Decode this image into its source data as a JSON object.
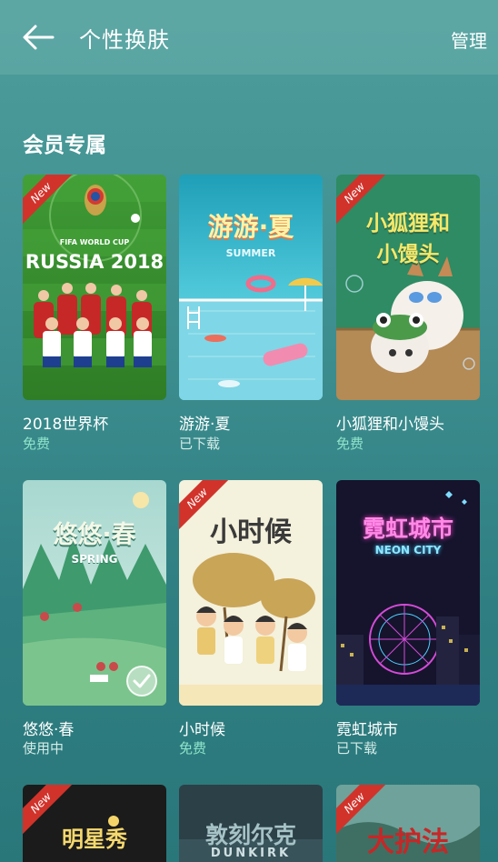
{
  "header": {
    "title": "个性换肤",
    "manage_label": "管理"
  },
  "section": {
    "title": "会员专属"
  },
  "themes": [
    {
      "name": "2018世界杯",
      "status": "免费",
      "new_badge": "New",
      "art_title": "RUSSIA 2018",
      "art_subtitle": "FIFA WORLD CUP"
    },
    {
      "name": "游游·夏",
      "status": "已下载",
      "art_title": "游游·夏",
      "art_subtitle": "SUMMER"
    },
    {
      "name": "小狐狸和小馒头",
      "status": "免费",
      "new_badge": "New",
      "art_title": "小狐狸和",
      "art_subtitle": "小馒头"
    },
    {
      "name": "悠悠·春",
      "status": "使用中",
      "art_title": "悠悠·春",
      "art_subtitle": "SPRING"
    },
    {
      "name": "小时候",
      "status": "免费",
      "new_badge": "New",
      "art_title": "小时候"
    },
    {
      "name": "霓虹城市",
      "status": "已下载",
      "art_title": "霓虹城市",
      "art_subtitle": "NEON CITY"
    },
    {
      "new_badge": "New",
      "art_title": "明星秀"
    },
    {
      "art_title": "敦刻尔克",
      "art_subtitle": "DUNKIRK"
    },
    {
      "new_badge": "New",
      "art_title": "大护法"
    }
  ],
  "colors": {
    "accent_free": "#8fe3c9",
    "ribbon": "#d1332b"
  }
}
